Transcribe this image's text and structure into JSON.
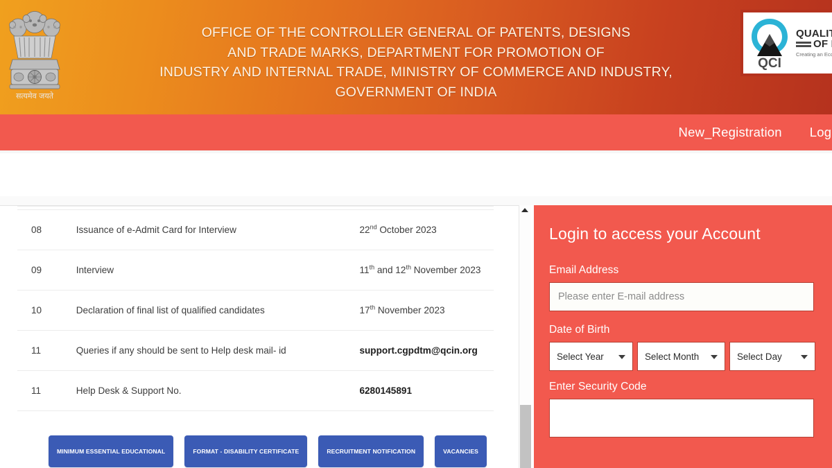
{
  "header": {
    "emblem_icon": "india-national-emblem-icon",
    "emblem_motto": "सत्यमेव जयते",
    "title_line1": "OFFICE OF THE CONTROLLER GENERAL OF PATENTS, DESIGNS",
    "title_line2": "AND TRADE MARKS, DEPARTMENT FOR PROMOTION OF",
    "title_line3": "INDUSTRY AND INTERNAL TRADE, MINISTRY OF COMMERCE AND INDUSTRY,",
    "title_line4": "GOVERNMENT OF INDIA",
    "gradient_from": "#f0a01e",
    "gradient_to": "#b5321e",
    "qci": {
      "logo_icon": "qci-logo-icon",
      "abbr": "QCI",
      "line1": "QUALITY C",
      "line2": "OF IN",
      "tagline": "Creating an Ecosy"
    }
  },
  "nav": {
    "background": "#f2594e",
    "items": [
      {
        "label": "New_Registration"
      },
      {
        "label": "Login"
      }
    ]
  },
  "schedule": {
    "rows": [
      {
        "sl": "08",
        "desc": "Issuance of e-Admit Card for Interview",
        "date_num": "22",
        "date_sup": "nd",
        "date_rest": " October 2023",
        "bold": false
      },
      {
        "sl": "09",
        "desc": "Interview",
        "date_num": "11",
        "date_sup": "th",
        "date_mid": " and 12",
        "date_sup2": "th",
        "date_rest": " November 2023",
        "bold": false
      },
      {
        "sl": "10",
        "desc": "Declaration of final list of qualified candidates",
        "date_num": "17",
        "date_sup": "th",
        "date_rest": " November 2023",
        "bold": false
      },
      {
        "sl": "11",
        "desc": "Queries if any should be sent to Help desk mail- id",
        "date_plain": "support.cgpdtm@qcin.org",
        "bold": true
      },
      {
        "sl": "11",
        "desc": "Help Desk & Support No.",
        "date_plain": "6280145891",
        "bold": true
      }
    ]
  },
  "buttons": {
    "color": "#3b5bb5",
    "items": [
      {
        "label": "MINIMUM ESSENTIAL EDUCATIONAL"
      },
      {
        "label": "FORMAT - DISABILITY CERTIFICATE"
      },
      {
        "label": "RECRUITMENT NOTIFICATION"
      },
      {
        "label": "VACANCIES"
      }
    ]
  },
  "scrollbar": {
    "up_arrow_icon": "scroll-up-arrow-icon",
    "thumb_position": "bottom"
  },
  "login": {
    "panel_color": "#f2594e",
    "title": "Login to access your Account",
    "email_label": "Email Address",
    "email_placeholder": "Please enter E-mail address",
    "email_value": "",
    "dob_label": "Date of Birth",
    "dob_year": "Select Year",
    "dob_month": "Select Month",
    "dob_day": "Select Day",
    "dropdown_icon": "chevron-down-icon",
    "security_label": "Enter Security Code",
    "security_value": ""
  }
}
